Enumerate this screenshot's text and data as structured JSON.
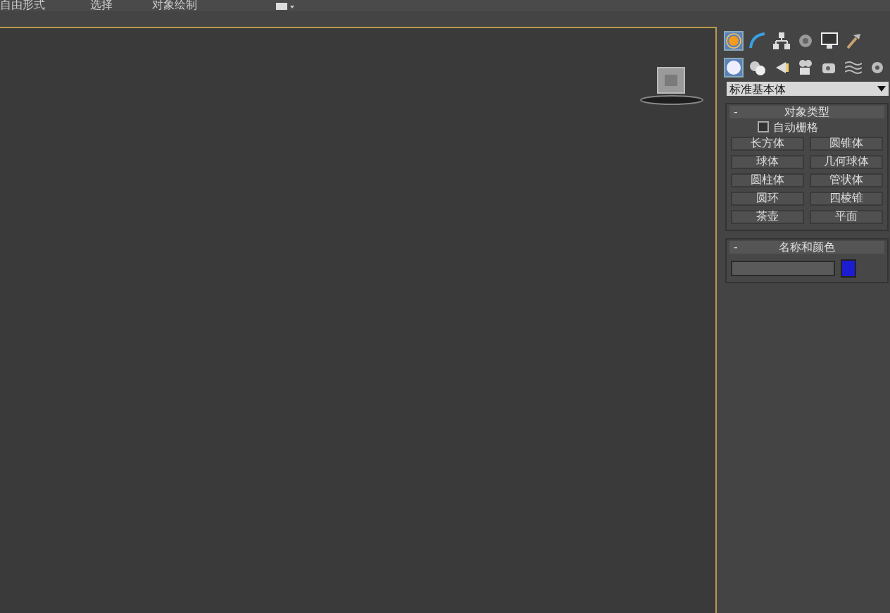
{
  "menu_bar": {
    "items": [
      "自由形式",
      "选择",
      "对象绘制"
    ]
  },
  "command_tabs": [
    {
      "kind": "sun",
      "selected": true
    },
    {
      "kind": "curve",
      "selected": false
    },
    {
      "kind": "hierarchy",
      "selected": false
    },
    {
      "kind": "circle",
      "selected": false
    },
    {
      "kind": "monitor",
      "selected": false
    },
    {
      "kind": "hammer",
      "selected": false
    }
  ],
  "category_tabs": [
    {
      "kind": "sphere",
      "selected": true
    },
    {
      "kind": "shapes",
      "selected": false
    },
    {
      "kind": "light",
      "selected": false
    },
    {
      "kind": "camera",
      "selected": false
    },
    {
      "kind": "tape",
      "selected": false
    },
    {
      "kind": "waves",
      "selected": false
    },
    {
      "kind": "gear",
      "selected": false
    }
  ],
  "category_dropdown": {
    "value": "标准基本体"
  },
  "object_type": {
    "toggle": "-",
    "title": "对象类型",
    "auto_grid": {
      "label": "自动栅格",
      "checked": false
    },
    "buttons": [
      "长方体",
      "圆锥体",
      "球体",
      "几何球体",
      "圆柱体",
      "管状体",
      "圆环",
      "四棱锥",
      "茶壶",
      "平面"
    ]
  },
  "name_and_color": {
    "toggle": "-",
    "title": "名称和颜色",
    "color": "#1c1cd0"
  }
}
